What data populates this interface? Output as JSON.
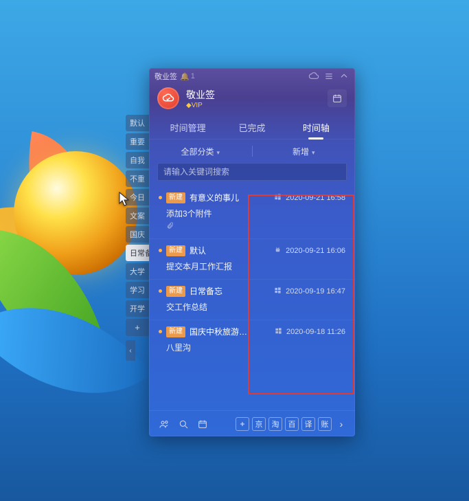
{
  "titlebar": {
    "app_name": "敬业签",
    "notif_count": "1"
  },
  "header": {
    "title": "敬业签",
    "vip_label": "VIP",
    "vip_diamond": "◆"
  },
  "tabs": [
    {
      "label": "时间管理"
    },
    {
      "label": "已完成"
    },
    {
      "label": "时间轴"
    }
  ],
  "active_tab_index": 2,
  "toolbar": {
    "category_label": "全部分类",
    "add_label": "新增"
  },
  "search": {
    "placeholder": "请输入关键词搜索"
  },
  "sidebar": {
    "items": [
      {
        "label": "默认"
      },
      {
        "label": "重要"
      },
      {
        "label": "自我"
      },
      {
        "label": "不重"
      },
      {
        "label": "今日"
      },
      {
        "label": "文案"
      },
      {
        "label": "国庆"
      },
      {
        "label": "日常备忘"
      },
      {
        "label": "大学"
      },
      {
        "label": "学习"
      },
      {
        "label": "开学"
      }
    ],
    "active_index": 7,
    "add_label": "+"
  },
  "badge": {
    "new_label": "新建"
  },
  "items": [
    {
      "title": "有意义的事儿",
      "line2": "添加3个附件",
      "platform": "windows",
      "datetime": "2020-09-21 16:58",
      "attach_icon": true
    },
    {
      "title": "默认",
      "line2": "提交本月工作汇报",
      "platform": "android",
      "datetime": "2020-09-21 16:06",
      "attach_icon": false
    },
    {
      "title": "日常备忘",
      "line2": "交工作总结",
      "platform": "windows",
      "datetime": "2020-09-19 16:47",
      "attach_icon": false
    },
    {
      "title": "国庆中秋旅游…",
      "line2": "八里沟",
      "platform": "windows",
      "datetime": "2020-09-18 11:26",
      "attach_icon": false
    }
  ],
  "footer": {
    "square_buttons": [
      "京",
      "淘",
      "百",
      "译",
      "账"
    ]
  }
}
